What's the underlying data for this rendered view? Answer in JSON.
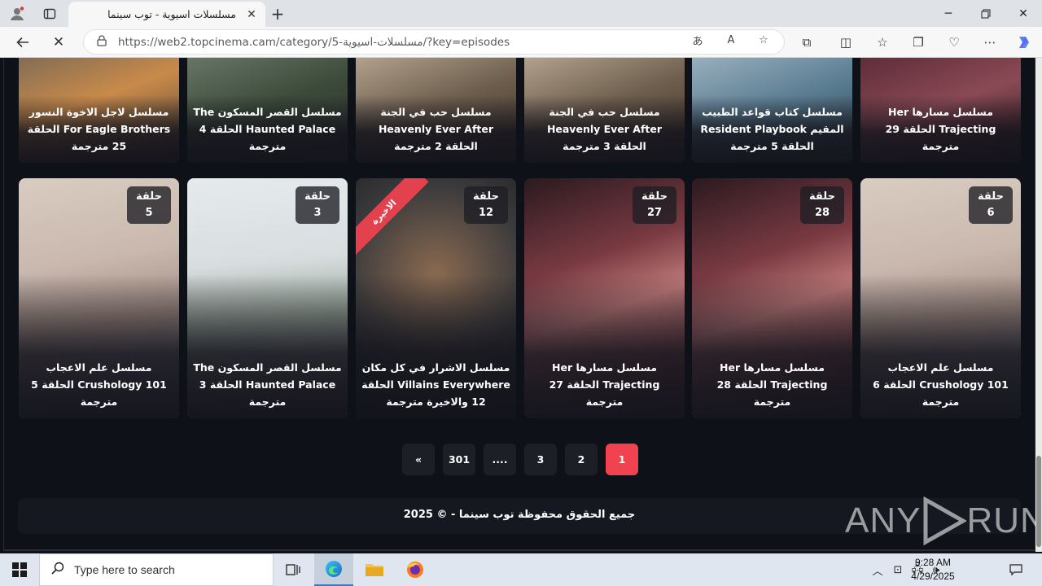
{
  "browser": {
    "tab_title": "مسلسلات اسيوية - توب سينما",
    "url": "https://web2.topcinema.cam/category/5-مسلسلات-اسيوية/?key=episodes"
  },
  "cards_top": [
    {
      "title": "مسلسل لاجل الاخوة النسور For Eagle Brothers الحلقة 25 مترجمة",
      "colors": [
        "#7a6a55",
        "#c98a4a",
        "#4a3f35"
      ]
    },
    {
      "title": "مسلسل القصر المسكون The Haunted Palace الحلقة 4 مترجمة",
      "colors": [
        "#6b7a6a",
        "#3c4a3a",
        "#2a2f29"
      ]
    },
    {
      "title": "مسلسل حب في الجنة Heavenly Ever After الحلقة 2 مترجمة",
      "colors": [
        "#b8a894",
        "#6d5d4c",
        "#3a3029"
      ]
    },
    {
      "title": "مسلسل حب في الجنة Heavenly Ever After الحلقة 3 مترجمة",
      "colors": [
        "#b8a894",
        "#6d5d4c",
        "#3a3029"
      ]
    },
    {
      "title": "مسلسل كتاب قواعد الطبيب المقيم Resident Playbook الحلقة 5 مترجمة",
      "colors": [
        "#9fb4c2",
        "#5a7d92",
        "#2c3d4a"
      ]
    },
    {
      "title": "مسلسل مسارها Her Trajecting الحلقة 29 مترجمة",
      "colors": [
        "#5a2a35",
        "#8a4a55",
        "#2a1519"
      ]
    }
  ],
  "cards_bottom": [
    {
      "title": "مسلسل علم الاعجاب Crushology 101 الحلقة 5 مترجمة",
      "badge_label": "حلقة",
      "badge_num": "5",
      "colors": [
        "#d9ccc0",
        "#a58f85",
        "#5e6a86"
      ]
    },
    {
      "title": "مسلسل القصر المسكون The Haunted Palace الحلقة 3 مترجمة",
      "badge_label": "حلقة",
      "badge_num": "3",
      "colors": [
        "#d8dee0",
        "#9aa89a",
        "#6a5a6e"
      ]
    },
    {
      "title": "مسلسل الاشرار في كل مكان Villains Everywhere الحلقة 12 والاخيرة مترجمة",
      "badge_label": "حلقة",
      "badge_num": "12",
      "ribbon": "الاخيرة",
      "colors": [
        "#3a3a3c",
        "#8a6a50",
        "#1a1a1c"
      ]
    },
    {
      "title": "مسلسل مسارها Her Trajecting الحلقة 27 مترجمة",
      "badge_label": "حلقة",
      "badge_num": "27",
      "colors": [
        "#2a1a1f",
        "#c07a7a",
        "#5a2a30"
      ]
    },
    {
      "title": "مسلسل مسارها Her Trajecting الحلقة 28 مترجمة",
      "badge_label": "حلقة",
      "badge_num": "28",
      "colors": [
        "#2a1a1f",
        "#c07a7a",
        "#5a2a30"
      ]
    },
    {
      "title": "مسلسل علم الاعجاب Crushology 101 الحلقة 6 مترجمة",
      "badge_label": "حلقة",
      "badge_num": "6",
      "colors": [
        "#d9ccc0",
        "#a58f85",
        "#5e6a86"
      ]
    }
  ],
  "pagination": {
    "items": [
      "«",
      "301",
      "....",
      "3",
      "2",
      "1"
    ],
    "active": "1",
    "accent": "#f0434f"
  },
  "footer": {
    "text": "جميع الحقوق محفوظة توب سينما - © 2025"
  },
  "watermark": "ANY RUN",
  "taskbar": {
    "search_placeholder": "Type here to search",
    "time": "9:28 AM",
    "date": "4/29/2025"
  }
}
